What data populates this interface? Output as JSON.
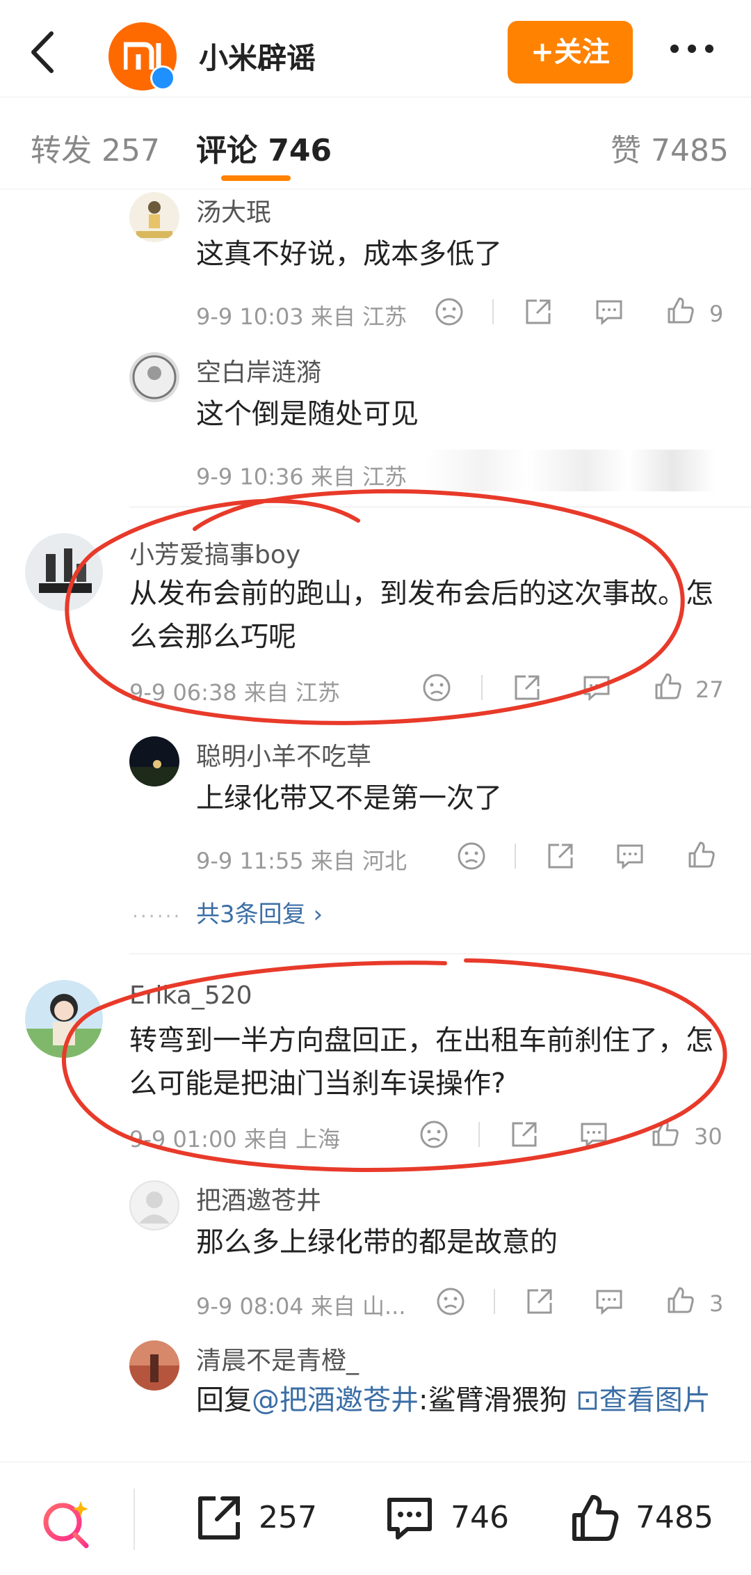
{
  "header": {
    "title": "小米辟谣",
    "follow_label": "+关注"
  },
  "tabs": [
    {
      "label": "转发 257"
    },
    {
      "label": "评论 746"
    },
    {
      "label": "赞 7485"
    }
  ],
  "comments": [
    {
      "name": "汤大珉",
      "text": "这真不好说，成本多低了",
      "meta": "9-9 10:03  来自 江苏",
      "likes": "9"
    },
    {
      "name": "空白岸涟漪",
      "text": "这个倒是随处可见",
      "meta": "9-9 10:36  来自 江苏"
    },
    {
      "name": "小芳爱搞事boy",
      "text": "从发布会前的跑山，到发布会后的这次事故。怎么会那么巧呢",
      "meta": "9-9 06:38  来自 江苏",
      "likes": "27"
    },
    {
      "name": "聪明小羊不吃草",
      "text": "上绿化带又不是第一次了",
      "meta": "9-9 11:55  来自 河北",
      "more_replies": "共3条回复 ›"
    },
    {
      "name": "Erika_520",
      "text": "转弯到一半方向盘回正，在出租车前刹住了，怎么可能是把油门当刹车误操作?",
      "meta": "9-9 01:00  来自 上海",
      "likes": "30"
    },
    {
      "name": "把酒邀苍井",
      "text": "那么多上绿化带的都是故意的",
      "meta": "9-9 08:04  来自 山...",
      "likes": "3"
    },
    {
      "name": "清晨不是青橙_",
      "reply_prefix": "回复",
      "reply_mention": "@把酒邀苍井",
      "reply_text": ":鲨臂滑猥狗 ",
      "reply_image": "⊡查看图片"
    }
  ],
  "bottom_bar": {
    "share_count": "257",
    "comment_count": "746",
    "like_count": "7485"
  },
  "colors": {
    "accent": "#ff8200",
    "annotation": "#e83a2a",
    "link": "#3b6ea5"
  }
}
